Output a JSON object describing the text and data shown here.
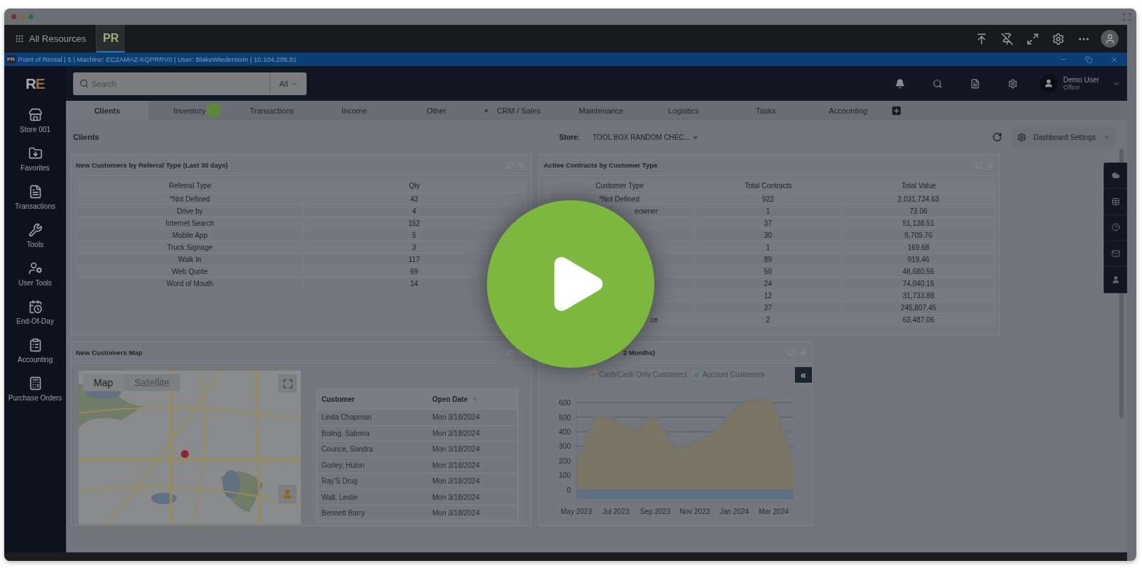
{
  "resource_bar": {
    "label": "All Resources",
    "tab": "PR"
  },
  "session_bar": {
    "logo": "PR",
    "text": "Point of Rental | 5 | Machine: EC2AMAZ-KQPRRV0 | User: BlakeWiederstein  | 10.104.205.91"
  },
  "header": {
    "logo": "RE",
    "search_placeholder": "Search",
    "filter": "All",
    "user_name": "Demo User",
    "user_role": "Office"
  },
  "sidebar": [
    {
      "label": "Store 001",
      "kind": "store"
    },
    {
      "label": "Favorites",
      "kind": "favorites"
    },
    {
      "label": "Transactions",
      "kind": "transactions"
    },
    {
      "label": "Tools",
      "kind": "tools"
    },
    {
      "label": "User Tools",
      "kind": "usertools"
    },
    {
      "label": "End-Of-Day",
      "kind": "endofday"
    },
    {
      "label": "Accounting",
      "kind": "accounting"
    },
    {
      "label": "Purchase Orders",
      "kind": "purchase"
    }
  ],
  "tabs": [
    {
      "label": "Clients",
      "selected": true,
      "flagged": false,
      "cursor": false
    },
    {
      "label": "Inventory",
      "selected": false,
      "flagged": false,
      "cursor": true
    },
    {
      "label": "Transactions",
      "selected": false,
      "flagged": false,
      "cursor": false
    },
    {
      "label": "Income",
      "selected": false,
      "flagged": false,
      "cursor": false
    },
    {
      "label": "Other",
      "selected": false,
      "flagged": false,
      "cursor": false
    },
    {
      "label": "CRM / Sales",
      "selected": false,
      "flagged": true,
      "cursor": false
    },
    {
      "label": "Maintenance",
      "selected": false,
      "flagged": false,
      "cursor": false
    },
    {
      "label": "Logistics",
      "selected": false,
      "flagged": false,
      "cursor": false
    },
    {
      "label": "Tasks",
      "selected": false,
      "flagged": false,
      "cursor": false
    },
    {
      "label": "Accounting",
      "selected": false,
      "flagged": false,
      "cursor": false
    }
  ],
  "page_title": "Clients",
  "store": {
    "label": "Store:",
    "value": "TOOL BOX RANDOM CHEC..."
  },
  "dashboard_settings": "Dashboard Settings",
  "referral_card": {
    "title": "New Customers by Referral Type (Last 30 days)",
    "columns": [
      "Referral Type",
      "Qty"
    ],
    "rows": [
      [
        "*Not Defined",
        "43"
      ],
      [
        "Drive by",
        "4"
      ],
      [
        "Internet Search",
        "152"
      ],
      [
        "Mobile App",
        "5"
      ],
      [
        "Truck Signage",
        "3"
      ],
      [
        "Walk In",
        "117"
      ],
      [
        "Web Quote",
        "69"
      ],
      [
        "Word of Mouth",
        "14"
      ]
    ]
  },
  "contracts_card": {
    "title": "Active Contracts by Customer Type",
    "columns": [
      "Customer Type",
      "Total Contracts",
      "Total Value"
    ],
    "rows": [
      {
        "customer_type": "*Not Defined",
        "total_contracts": "922",
        "total_value": "2,031,734.63"
      },
      {
        "customer_type": "eowner",
        "cut": true,
        "total_contracts": "1",
        "total_value": "73.06"
      },
      {
        "total_contracts": "37",
        "total_value": "51,138.51"
      },
      {
        "total_contracts": "30",
        "total_value": "9,709.76"
      },
      {
        "total_contracts": "1",
        "total_value": "169.68"
      },
      {
        "total_contracts": "89",
        "total_value": "919.46"
      },
      {
        "total_contracts": "50",
        "total_value": "48,680.56"
      },
      {
        "total_contracts": "24",
        "total_value": "74,040.15"
      },
      {
        "total_contracts": "12",
        "total_value": "31,733.88"
      },
      {
        "total_contracts": "37",
        "total_value": "245,807.45"
      },
      {
        "customer_type": "ce",
        "cut": true,
        "total_contracts": "2",
        "total_value": "63,487.06"
      }
    ]
  },
  "map_card": {
    "title": "New Customers Map",
    "map_buttons": [
      {
        "label": "Map",
        "selected": true
      },
      {
        "label": "Satellite",
        "selected": false
      }
    ],
    "columns": [
      "Customer",
      "Open Date"
    ],
    "rows": [
      [
        "Linda Chapman",
        "Mon 3/18/2024"
      ],
      [
        "Boling, Sabrina",
        "Mon 3/18/2024"
      ],
      [
        "Counce, Sandra",
        "Mon 3/18/2024"
      ],
      [
        "Gorley, Hulon",
        "Mon 3/18/2024"
      ],
      [
        "Ray'S Drug",
        "Mon 3/18/2024"
      ],
      [
        "Wall, Leslie",
        "Mon 3/18/2024"
      ],
      [
        "Bennett Barry",
        "Mon 3/18/2024"
      ]
    ]
  },
  "chart_card": {
    "title": "2 Months)",
    "collapse": "«",
    "chart_data": {
      "type": "area",
      "grid": true,
      "categories": [
        "May 2023",
        null,
        "Jul 2023",
        null,
        "Sep 2023",
        null,
        "Nov 2023",
        null,
        "Jan 2024",
        null,
        "Mar 2024",
        null
      ],
      "ylim": [
        -75,
        640
      ],
      "yticks": [
        0,
        100,
        200,
        300,
        400,
        500,
        600
      ],
      "series": [
        {
          "name": "Cash/Cash Only Customers",
          "color": "#7a7466",
          "values": [
            210,
            500,
            480,
            430,
            500,
            310,
            340,
            410,
            560,
            630,
            590,
            210
          ]
        },
        {
          "name": "Account Customers",
          "color": "#5f6f84",
          "values": [
            -65,
            -65,
            -65,
            -65,
            -65,
            -65,
            -65,
            -65,
            -65,
            -65,
            -65,
            -65
          ]
        }
      ]
    }
  }
}
